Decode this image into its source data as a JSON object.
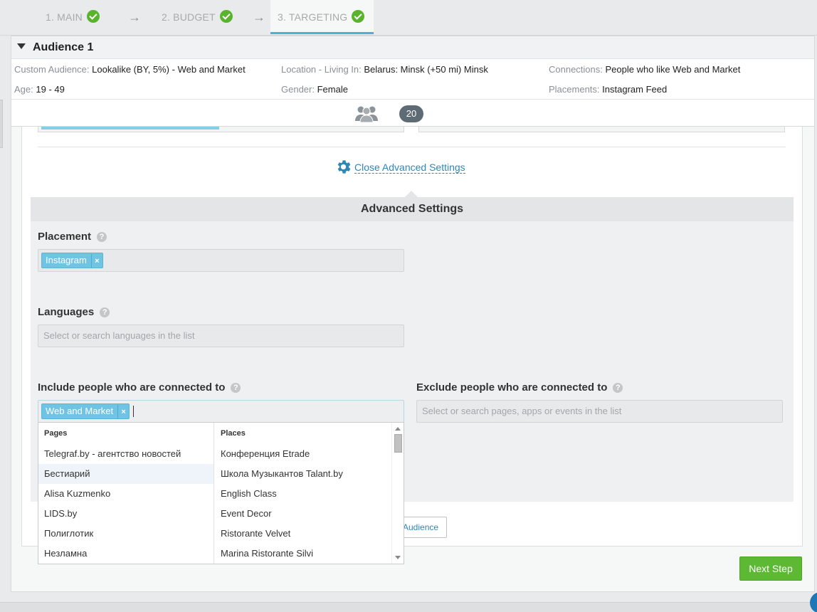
{
  "steps": [
    {
      "label": "1. MAIN"
    },
    {
      "label": "2. BUDGET"
    },
    {
      "label": "3. TARGETING"
    }
  ],
  "step_arrow": "→",
  "summary": {
    "title": "Audience 1",
    "custom_audience_key": "Custom Audience:",
    "custom_audience_val": "Lookalike (BY, 5%) - Web and Market",
    "location_key": "Location - Living In:",
    "location_val": "Belarus: Minsk (+50 mi) Minsk",
    "connections_key": "Connections:",
    "connections_val": "People who like Web and Market",
    "age_key": "Age:",
    "age_val": "19 - 49",
    "gender_key": "Gender:",
    "gender_val": "Female",
    "placements_key": "Placements:",
    "placements_val": "Instagram Feed",
    "count": "20"
  },
  "close_advanced": "Close Advanced Settings",
  "advanced": {
    "header": "Advanced Settings",
    "placement_label": "Placement",
    "placement_tag": "Instagram",
    "languages_label": "Languages",
    "languages_placeholder": "Select or search languages in the list",
    "include_label": "Include people who are connected to",
    "include_tag": "Web and Market",
    "exclude_label": "Exclude people who are connected to",
    "exclude_placeholder": "Select or search pages, apps or events in the list",
    "help": "?",
    "remove": "×"
  },
  "dropdown": {
    "pages_header": "Pages",
    "places_header": "Places",
    "pages": [
      "Telegraf.by - агентство новостей",
      "Бестиарий",
      "Alisa Kuzmenko",
      "LIDS.by",
      "Полиглотик",
      "Незламна"
    ],
    "places": [
      "Конференция Etrade",
      "Школа Музыкантов Talant.by",
      "English Class",
      "Event Decor",
      "Ristorante Velvet",
      "Marina Ristorante Silvi"
    ]
  },
  "buttons": {
    "add_audience_partial": "Audience",
    "next_step": "Next Step"
  },
  "colors": {
    "accent": "#4ab0d8",
    "success": "#59b32d",
    "link": "#2e87b5",
    "tag": "#6fc4e4"
  }
}
